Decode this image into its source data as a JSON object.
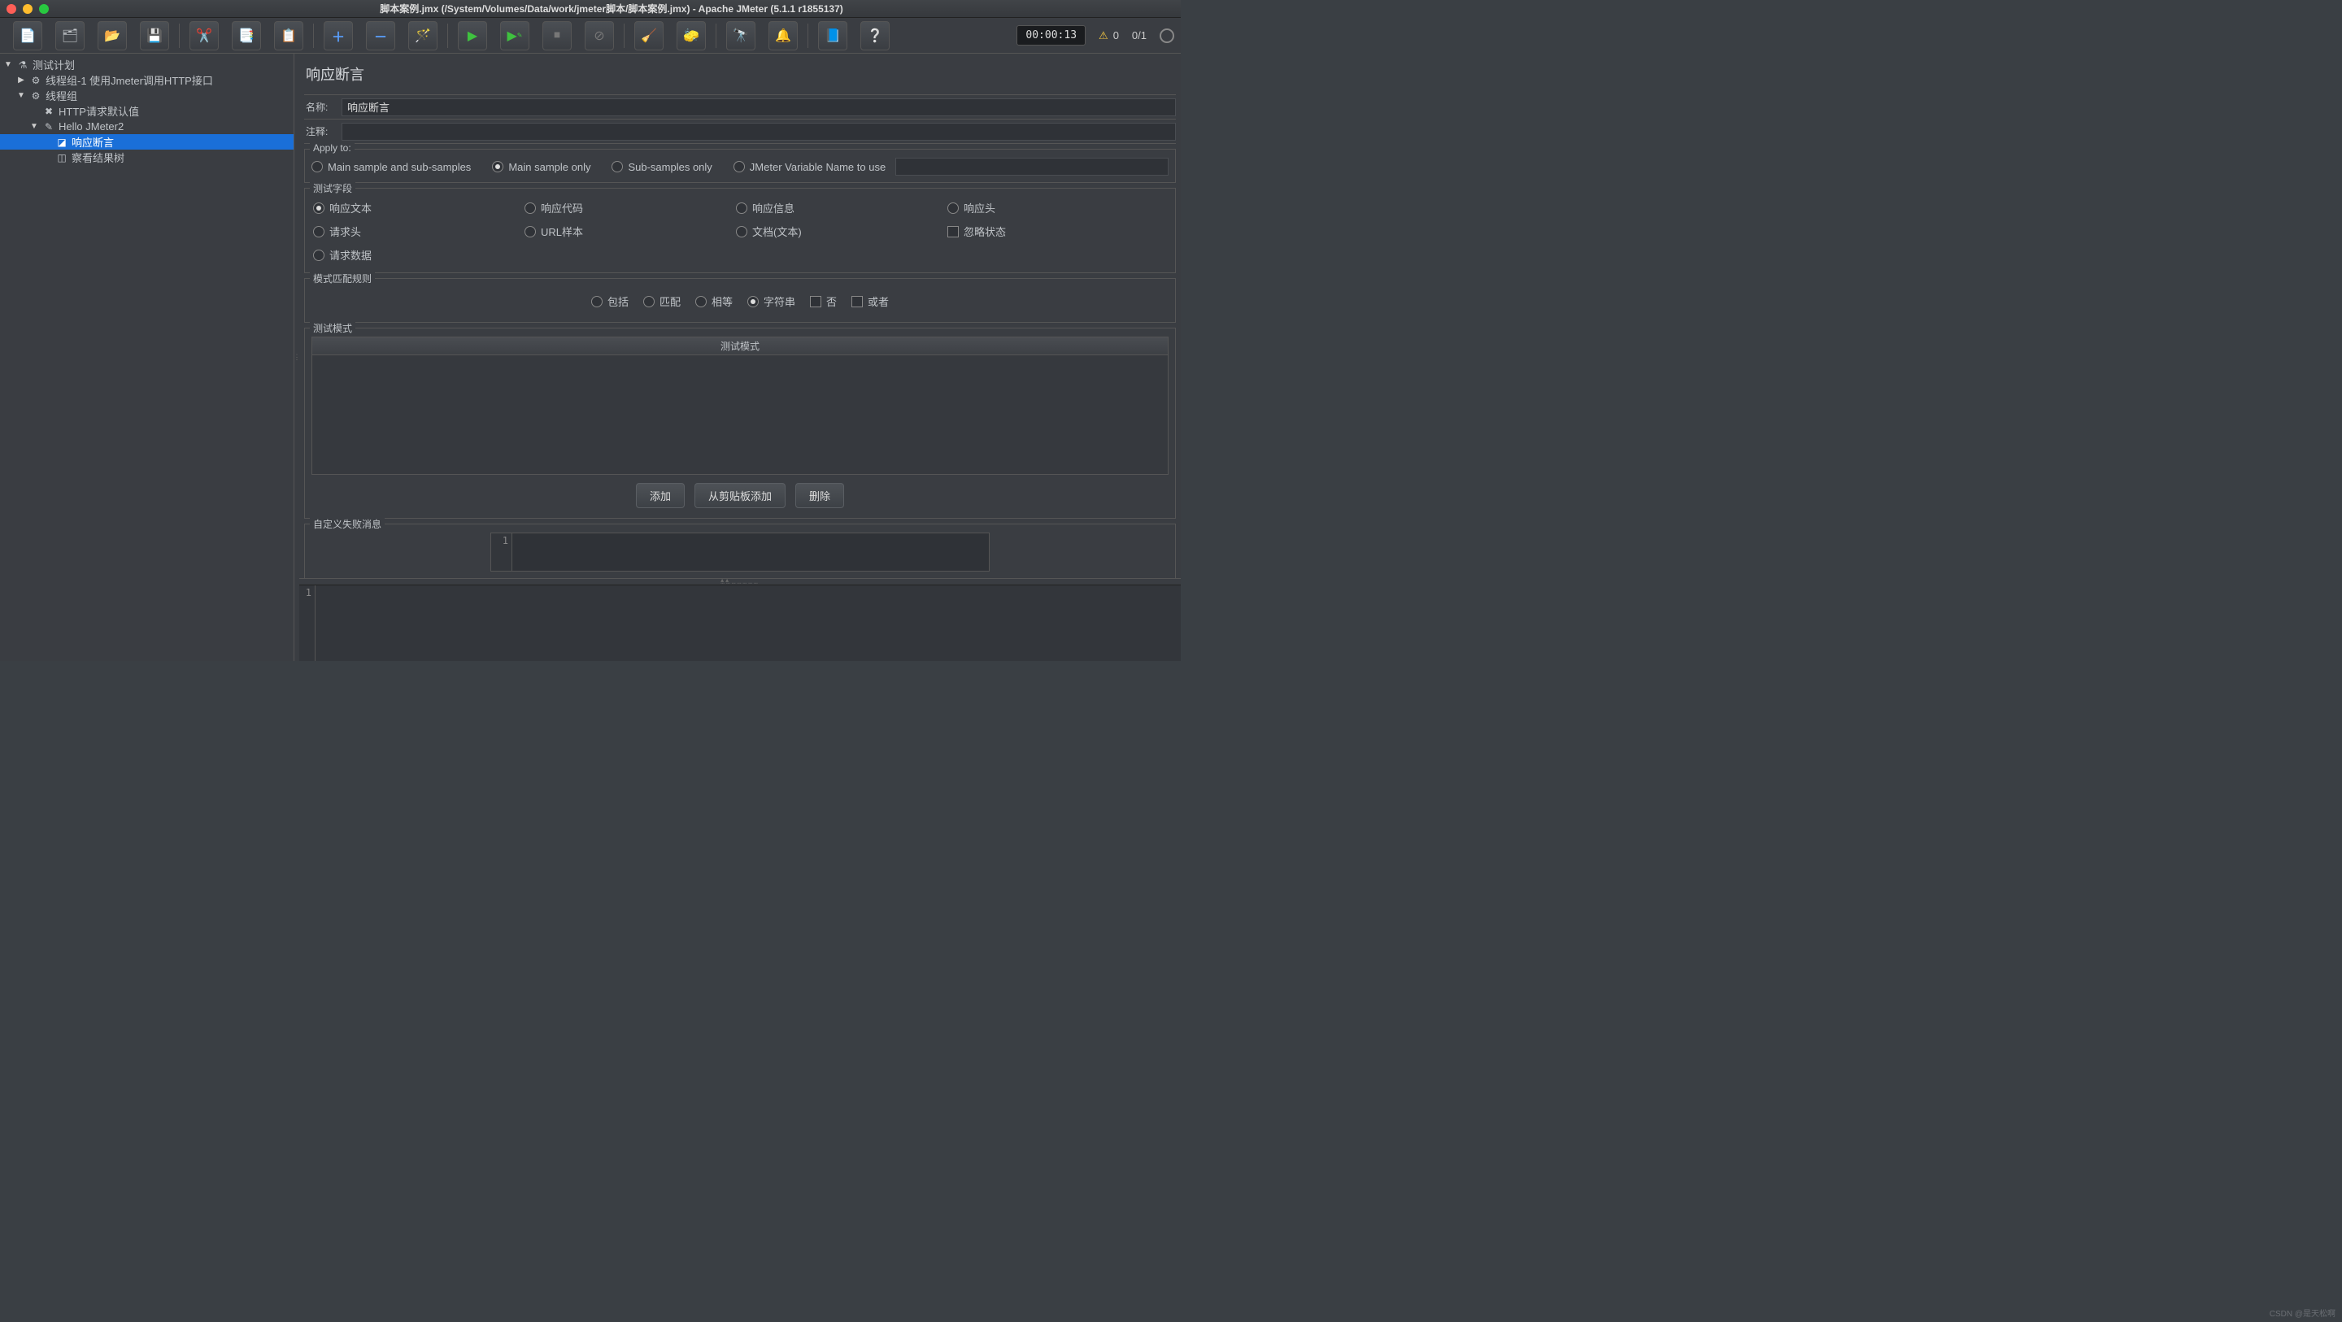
{
  "title": "脚本案例.jmx (/System/Volumes/Data/work/jmeter脚本/脚本案例.jmx) - Apache JMeter (5.1.1 r1855137)",
  "toolbar": {
    "time": "00:00:13",
    "warn_count": "0",
    "run_count": "0/1"
  },
  "tree": {
    "items": [
      {
        "indent": 0,
        "toggle": "▼",
        "icon": "⚗",
        "label": "测试计划"
      },
      {
        "indent": 1,
        "toggle": "▶",
        "icon": "⚙",
        "label": "线程组-1 使用Jmeter调用HTTP接口"
      },
      {
        "indent": 1,
        "toggle": "▼",
        "icon": "⚙",
        "label": "线程组"
      },
      {
        "indent": 2,
        "toggle": "",
        "icon": "✖",
        "label": "HTTP请求默认值"
      },
      {
        "indent": 2,
        "toggle": "▼",
        "icon": "✎",
        "label": "Hello JMeter2"
      },
      {
        "indent": 3,
        "toggle": "",
        "icon": "◪",
        "label": "响应断言",
        "selected": true
      },
      {
        "indent": 3,
        "toggle": "",
        "icon": "◫",
        "label": "察看结果树"
      }
    ]
  },
  "editor": {
    "heading": "响应断言",
    "name_label": "名称:",
    "name_value": "响应断言",
    "comment_label": "注释:",
    "comment_value": "",
    "apply_to": {
      "legend": "Apply to:",
      "options": [
        "Main sample and sub-samples",
        "Main sample only",
        "Sub-samples only",
        "JMeter Variable Name to use"
      ],
      "selected": 1
    },
    "test_field": {
      "legend": "测试字段",
      "radios": [
        "响应文本",
        "响应代码",
        "响应信息",
        "响应头",
        "请求头",
        "URL样本",
        "文档(文本)"
      ],
      "selected": 0,
      "check_ignore": "忽略状态",
      "last_radio": "请求数据"
    },
    "rule": {
      "legend": "模式匹配规则",
      "radios": [
        "包括",
        "匹配",
        "相等",
        "字符串"
      ],
      "selected": 3,
      "checks": [
        "否",
        "或者"
      ]
    },
    "patterns": {
      "legend": "测试模式",
      "col_header": "测试模式",
      "btn_add": "添加",
      "btn_clip": "从剪贴板添加",
      "btn_del": "删除"
    },
    "fail_msg": {
      "legend": "自定义失败消息",
      "line": "1"
    }
  },
  "log_line": "1",
  "watermark": "CSDN @是天松啊"
}
